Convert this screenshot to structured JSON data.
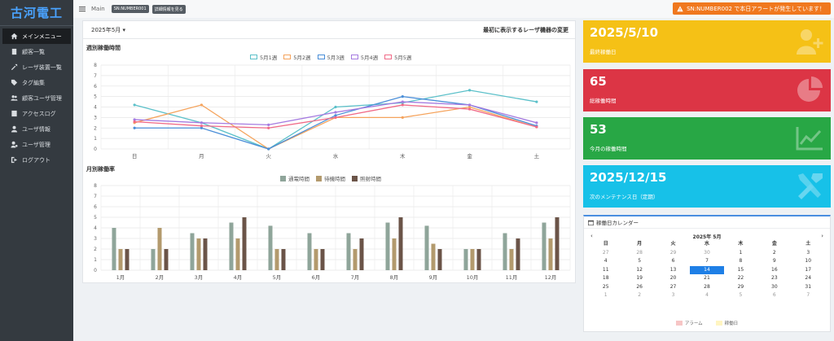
{
  "sidebar": {
    "brand": "古河電工",
    "items": [
      {
        "label": "メインメニュー",
        "icon": "home-icon"
      },
      {
        "label": "顧客一覧",
        "icon": "building-icon"
      },
      {
        "label": "レーザ装置一覧",
        "icon": "tools-icon"
      },
      {
        "label": "タグ編集",
        "icon": "tag-icon"
      },
      {
        "label": "顧客ユーザ管理",
        "icon": "users-icon"
      },
      {
        "label": "アクセスログ",
        "icon": "log-icon"
      },
      {
        "label": "ユーザ情報",
        "icon": "user-icon"
      },
      {
        "label": "ユーザ管理",
        "icon": "user-cog-icon"
      },
      {
        "label": "ログアウト",
        "icon": "logout-icon"
      }
    ]
  },
  "header": {
    "crumb": "Main",
    "badge1": "SN:NUMBER001",
    "badge2": "詳細情報を見る",
    "alert": "SN:NUMBER002 で本日アラートが発生しています！",
    "alert_color": "#f0781e"
  },
  "card": {
    "month_select": "2025年5月 ▾",
    "link": "最初に表示するレーザ機器の変更"
  },
  "chart_data": [
    {
      "type": "line",
      "title": "週別稼働時間",
      "categories": [
        "日",
        "月",
        "火",
        "水",
        "木",
        "金",
        "土"
      ],
      "ylim": [
        0,
        8
      ],
      "yticks": [
        0,
        1,
        2,
        3,
        4,
        5,
        6,
        7,
        8
      ],
      "legend_position": "top",
      "series": [
        {
          "name": "5月1週",
          "color": "#5bc0c9",
          "values": [
            4.2,
            2.5,
            0,
            4,
            4.4,
            5.6,
            4.5
          ]
        },
        {
          "name": "5月2週",
          "color": "#f5a35c",
          "values": [
            2.5,
            4.2,
            0,
            3,
            3,
            4,
            2.1
          ]
        },
        {
          "name": "5月3週",
          "color": "#4a8ed8",
          "values": [
            2,
            2,
            0,
            3.2,
            5,
            4.2,
            2.2
          ]
        },
        {
          "name": "5月4週",
          "color": "#a57be0",
          "values": [
            2.8,
            2.5,
            2.3,
            3.5,
            4.5,
            4.2,
            2.5
          ]
        },
        {
          "name": "5月5週",
          "color": "#f06a87",
          "values": [
            2.6,
            2.2,
            2,
            3,
            4.2,
            3.8,
            2.1
          ]
        }
      ]
    },
    {
      "type": "bar",
      "title": "月別稼働率",
      "categories": [
        "1月",
        "2月",
        "3月",
        "4月",
        "5月",
        "6月",
        "7月",
        "8月",
        "9月",
        "10月",
        "11月",
        "12月"
      ],
      "ylim": [
        0,
        8
      ],
      "yticks": [
        0,
        1,
        2,
        3,
        4,
        5,
        6,
        7,
        8
      ],
      "legend_position": "top",
      "series": [
        {
          "name": "通電時間",
          "color": "#8fa59a",
          "values": [
            4,
            2,
            3.5,
            4.5,
            4.2,
            3.5,
            3.5,
            4.5,
            4.2,
            2,
            3.5,
            4.5
          ]
        },
        {
          "name": "待機時間",
          "color": "#b39a6d",
          "values": [
            2,
            4,
            3,
            3,
            2,
            2,
            2,
            3,
            2.5,
            2,
            2,
            3
          ]
        },
        {
          "name": "照射時間",
          "color": "#6b5448",
          "values": [
            2,
            2,
            3,
            5,
            2,
            2,
            3,
            5,
            2,
            2,
            3,
            5
          ]
        }
      ]
    }
  ],
  "kpis": [
    {
      "value": "2025/5/10",
      "label": "最終稼働日",
      "color": "#f5c116",
      "icon": "user-plus-icon"
    },
    {
      "value": "65",
      "label": "総稼働時間",
      "color": "#dc3545",
      "icon": "pie-chart-icon"
    },
    {
      "value": "53",
      "label": "今月の稼働時間",
      "color": "#28a745",
      "icon": "line-chart-icon"
    },
    {
      "value": "2025/12/15",
      "label": "次のメンテナンス日（定期）",
      "color": "#17c1e8",
      "icon": "tools-icon"
    }
  ],
  "calendar": {
    "title": "稼働日カレンダー",
    "prev": "‹",
    "next": "›",
    "month_title": "2025年 5月",
    "weekdays": [
      "日",
      "月",
      "火",
      "水",
      "木",
      "金",
      "土"
    ],
    "weeks": [
      [
        "27",
        "28",
        "29",
        "30",
        "1",
        "2",
        "3"
      ],
      [
        "4",
        "5",
        "6",
        "7",
        "8",
        "9",
        "10"
      ],
      [
        "11",
        "12",
        "13",
        "14",
        "15",
        "16",
        "17"
      ],
      [
        "18",
        "19",
        "20",
        "21",
        "22",
        "23",
        "24"
      ],
      [
        "25",
        "26",
        "27",
        "28",
        "29",
        "30",
        "31"
      ],
      [
        "1",
        "2",
        "3",
        "4",
        "5",
        "6",
        "7"
      ]
    ],
    "selected": "14",
    "legend": [
      {
        "label": "アラーム",
        "color": "#f7c6c6"
      },
      {
        "label": "稼働日",
        "color": "#fff5c2"
      }
    ]
  }
}
